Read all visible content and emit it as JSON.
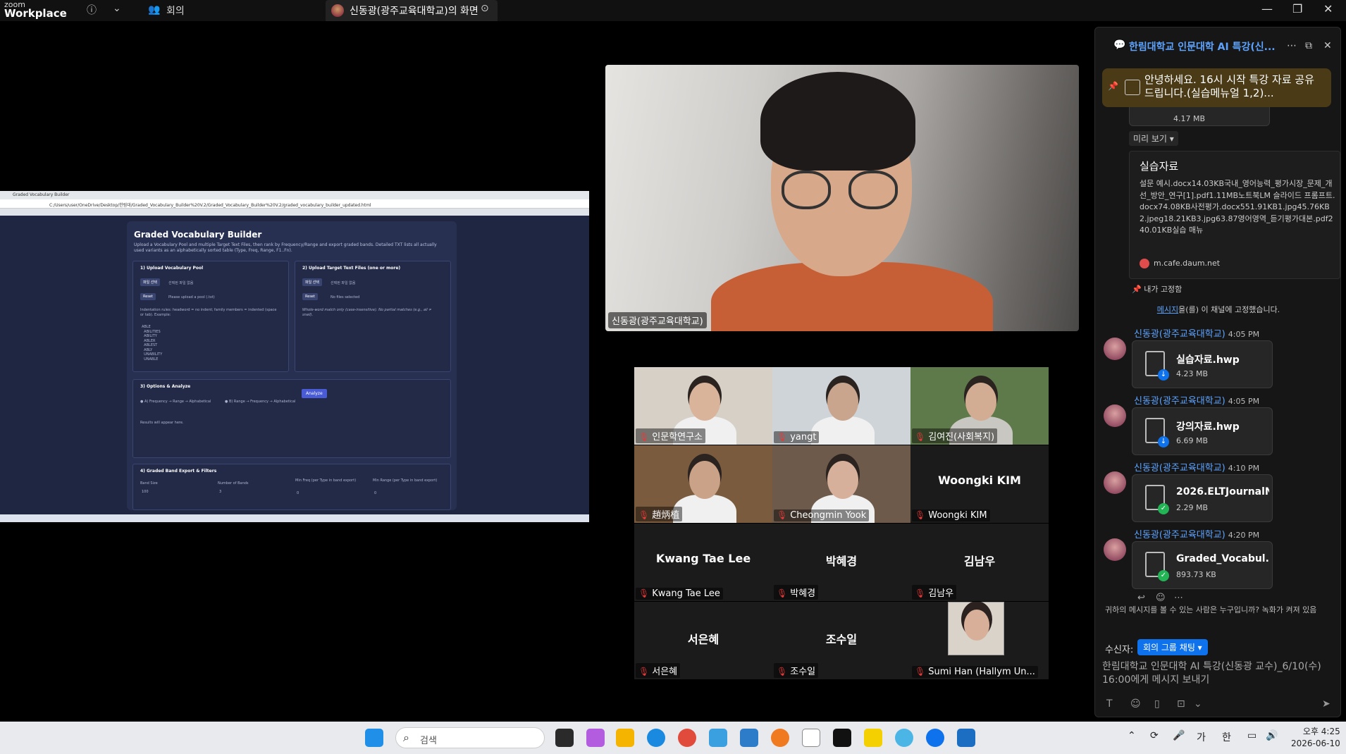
{
  "titlebar": {
    "app_line1": "zoom",
    "app_line2": "Workplace",
    "info_icon": "info-icon",
    "meeting_label": "회의",
    "share_label": "신동광(광주교육대학교)의 화면"
  },
  "shared_screen": {
    "tab_title": "Graded Vocabulary Builder",
    "url": "C:/Users/user/OneDrive/Desktop/한림대/Graded_Vocabulary_Builder%20V.2/Graded_Vocabulary_Builder%20V.2/graded_vocabulary_builder_updated.html",
    "title": "Graded Vocabulary Builder",
    "desc": "Upload a Vocabulary Pool and multiple Target Text Files, then rank by Frequency/Range and export graded bands. Detailed TXT lists all actually used variants as an alphabetically sorted table (Type, Freq, Range, F1..Fn).",
    "panel1_title": "1) Upload Vocabulary Pool",
    "panel1_btn": "파일 선택",
    "panel1_file": "선택된 파일 없음",
    "panel1_reset": "Reset",
    "panel1_hint": "Please upload a pool (.txt)",
    "panel1_rules": "Indentation rules: headword = no indent; family members = indented (space or tab). Example:",
    "panel1_example": "ABLE\n  ABILITIES\n  ABILITY\n  ABLER\n  ABLEST\n  ABLY\n  UNABILITY\n  UNABLE",
    "panel2_title": "2) Upload Target Text Files (one or more)",
    "panel2_btn": "파일 선택",
    "panel2_file": "선택된 파일 없음",
    "panel2_reset": "Reset",
    "panel2_hint": "No files selected",
    "panel2_note": "Whole-word match only (case-insensitive). No partial matches (e.g., ail ≠ snail).",
    "panel3_title": "3) Options & Analyze",
    "opt_a": "A) Frequency → Range → Alphabetical",
    "opt_b": "B) Range → Frequency → Alphabetical",
    "analyze": "Analyze",
    "results": "Results will appear here.",
    "panel4_title": "4) Graded Band Export & Filters",
    "band_size_label": "Band Size",
    "band_size_value": "100",
    "num_bands_label": "Number of Bands",
    "num_bands_value": "3",
    "min_freq_label": "Min Freq (per Type in band export)",
    "min_freq_value": "0",
    "min_range_label": "Min Range (per Type in band export)",
    "min_range_value": "0"
  },
  "main_video": {
    "name": "신동광(광주교육대학교)"
  },
  "gallery": [
    {
      "name": "인문학연구소",
      "muted": true,
      "video": true
    },
    {
      "name": "yangt",
      "muted": true,
      "video": true
    },
    {
      "name": "김여진(사회복지)",
      "muted": true,
      "video": true
    },
    {
      "name": "趙炳植",
      "muted": true,
      "video": true
    },
    {
      "name": "Cheongmin Yook",
      "muted": true,
      "video": true
    },
    {
      "name": "Woongki KIM",
      "big": "Woongki KIM",
      "muted": true,
      "video": false
    },
    {
      "name": "Kwang Tae Lee",
      "big": "Kwang Tae Lee",
      "muted": true,
      "video": false
    },
    {
      "name": "박혜경",
      "big": "박혜경",
      "muted": true,
      "video": false
    },
    {
      "name": "김남우",
      "big": "김남우",
      "muted": true,
      "video": false
    },
    {
      "name": "서은혜",
      "big": "서은혜",
      "muted": true,
      "video": false
    },
    {
      "name": "조수일",
      "big": "조수일",
      "muted": true,
      "video": false
    },
    {
      "name": "Sumi Han (Hallym Un...",
      "muted": true,
      "video": true
    }
  ],
  "chat": {
    "title": "한림대학교 인문대학 AI 특강(신...",
    "pinned_text": "안녕하세요. 16시 시작 특강 자료 공유 드립니다.(실습메뉴얼 1,2)...",
    "top_file_size": "4.17 MB",
    "preview_label": "미리 보기 ▾",
    "attach_title": "실습자료",
    "attach_body": "설문 예시.docx14.03KB국내_영어능력_평가시장_문제_개선_방안_연구[1].pdf1.11MB노트북LM 슬라이드 프롬프트.docx74.08KB사전평가.docx551.91KB1.jpg45.76KB2.jpeg18.21KB3.jpg63.87영어영역_듣기평가대본.pdf240.01KB실습 매뉴",
    "attach_source": "m.cafe.daum.net",
    "pinned_by_me": "내가 고정함",
    "pin_notice_link": "메시지",
    "pin_notice_rest": "을(를) 이 채널에 고정했습니다.",
    "messages": [
      {
        "sender": "신동광(광주교육대학교)",
        "time": "4:05 PM",
        "file": "실습자료.hwp",
        "size": "4.23 MB",
        "badge": "↓",
        "badge_color": "#0e72ed"
      },
      {
        "sender": "신동광(광주교육대학교)",
        "time": "4:05 PM",
        "file": "강의자료.hwp",
        "size": "6.69 MB",
        "badge": "↓",
        "badge_color": "#0e72ed"
      },
      {
        "sender": "신동광(광주교육대학교)",
        "time": "4:10 PM",
        "file": "2026.ELTJournalN...",
        "size": "2.29 MB",
        "badge": "✓",
        "badge_color": "#22b455"
      },
      {
        "sender": "신동광(광주교육대학교)",
        "time": "4:20 PM",
        "file": "Graded_Vocabul...",
        "size": "893.73 KB",
        "badge": "✓",
        "badge_color": "#22b455"
      }
    ],
    "visibility_notice": "귀하의 메시지를 볼 수 있는 사람은 누구입니까? 녹화가 켜져 있음",
    "recipient_label": "수신자:",
    "recipient_btn": "회의 그룹 채팅 ▾",
    "compose_placeholder": "한림대학교 인문대학 AI 특강(신동광 교수)_6/10(수) 16:00에게 메시지 보내기"
  },
  "taskbar": {
    "search_placeholder": "검색",
    "ime1": "가",
    "ime2": "한",
    "time": "오후 4:25",
    "date": "2026-06-10"
  },
  "colors": {
    "zoom_blue": "#0e72ed",
    "chat_link": "#5ca3ff",
    "muted_red": "#e63939",
    "pinned_bg": "#4a3a16"
  }
}
